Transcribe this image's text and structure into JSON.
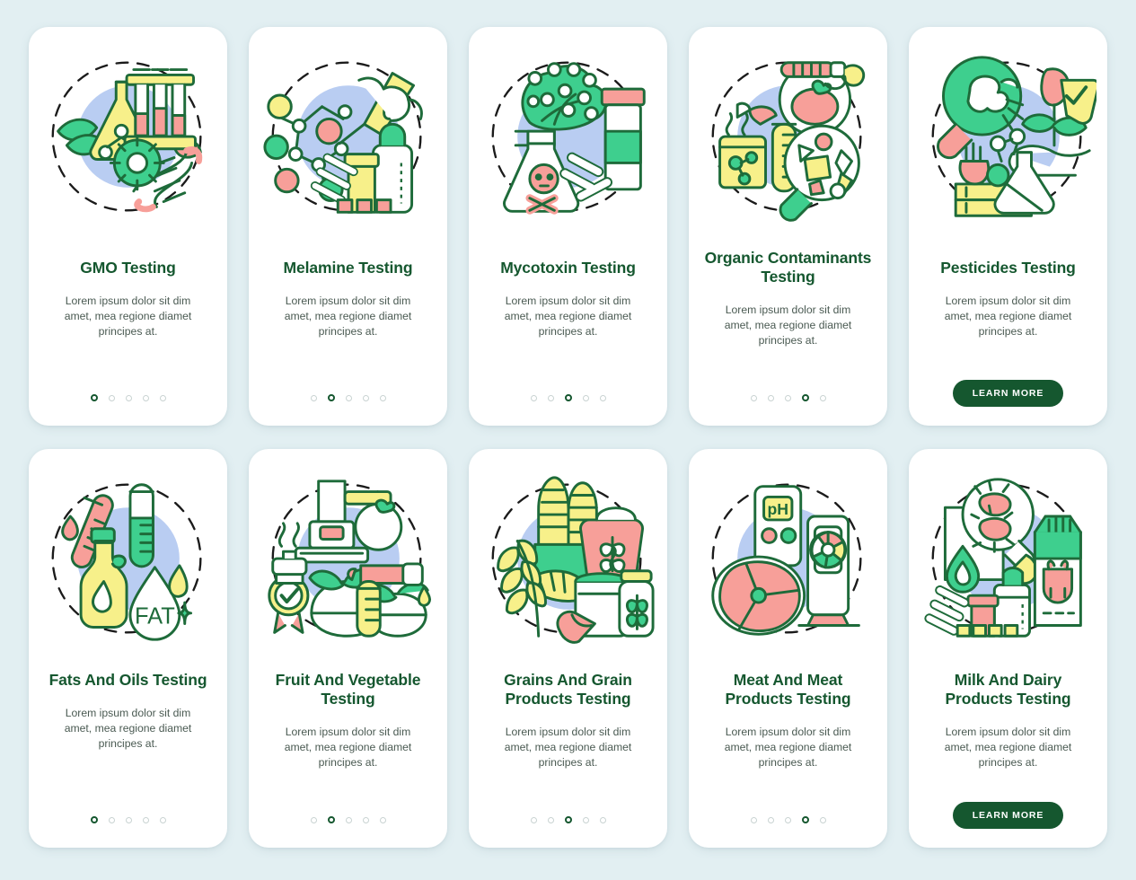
{
  "page": {
    "background_color": "#e2eff2",
    "card_background": "#ffffff",
    "title_color": "#15572f",
    "body_color": "#4a5a52",
    "accent_green": "#3ecf8e",
    "accent_yellow": "#f7f08a",
    "accent_pink": "#f79f99",
    "accent_blue": "#b9cdf2",
    "outline_color": "#1e6b3a"
  },
  "cards": [
    {
      "title": "GMO Testing",
      "body": "Lorem ipsum dolor sit dim amet, mea regione diamet principes at.",
      "icon": "gmo-testing-illustration",
      "dots": 5,
      "active_dot": 1,
      "cta": null
    },
    {
      "title": "Melamine Testing",
      "body": "Lorem ipsum dolor sit dim amet, mea regione diamet principes at.",
      "icon": "melamine-testing-illustration",
      "dots": 5,
      "active_dot": 2,
      "cta": null
    },
    {
      "title": "Mycotoxin Testing",
      "body": "Lorem ipsum dolor sit dim amet, mea regione diamet principes at.",
      "icon": "mycotoxin-testing-illustration",
      "dots": 5,
      "active_dot": 3,
      "cta": null
    },
    {
      "title": "Organic Contaminants Testing",
      "body": "Lorem ipsum dolor sit dim amet, mea regione diamet principes at.",
      "icon": "organic-contaminants-testing-illustration",
      "dots": 5,
      "active_dot": 4,
      "cta": null
    },
    {
      "title": "Pesticides Testing",
      "body": "Lorem ipsum dolor sit dim amet, mea regione diamet principes at.",
      "icon": "pesticides-testing-illustration",
      "dots": 0,
      "active_dot": 0,
      "cta": "LEARN MORE"
    },
    {
      "title": "Fats And Oils Testing",
      "body": "Lorem ipsum dolor sit dim amet, mea regione diamet principes at.",
      "icon": "fats-and-oils-testing-illustration",
      "dots": 5,
      "active_dot": 1,
      "cta": null
    },
    {
      "title": "Fruit And Vegetable Testing",
      "body": "Lorem ipsum dolor sit dim amet, mea regione diamet principes at.",
      "icon": "fruit-and-vegetable-testing-illustration",
      "dots": 5,
      "active_dot": 2,
      "cta": null
    },
    {
      "title": "Grains And Grain Products Testing",
      "body": "Lorem ipsum dolor sit dim amet, mea regione diamet principes at.",
      "icon": "grains-and-grain-products-testing-illustration",
      "dots": 5,
      "active_dot": 3,
      "cta": null
    },
    {
      "title": "Meat And Meat Products Testing",
      "body": "Lorem ipsum dolor sit dim amet, mea regione diamet principes at.",
      "icon": "meat-and-meat-products-testing-illustration",
      "dots": 5,
      "active_dot": 4,
      "cta": null
    },
    {
      "title": "Milk And Dairy Products Testing",
      "body": "Lorem ipsum dolor sit dim amet, mea regione diamet principes at.",
      "icon": "milk-and-dairy-products-testing-illustration",
      "dots": 0,
      "active_dot": 0,
      "cta": "LEARN MORE"
    }
  ]
}
